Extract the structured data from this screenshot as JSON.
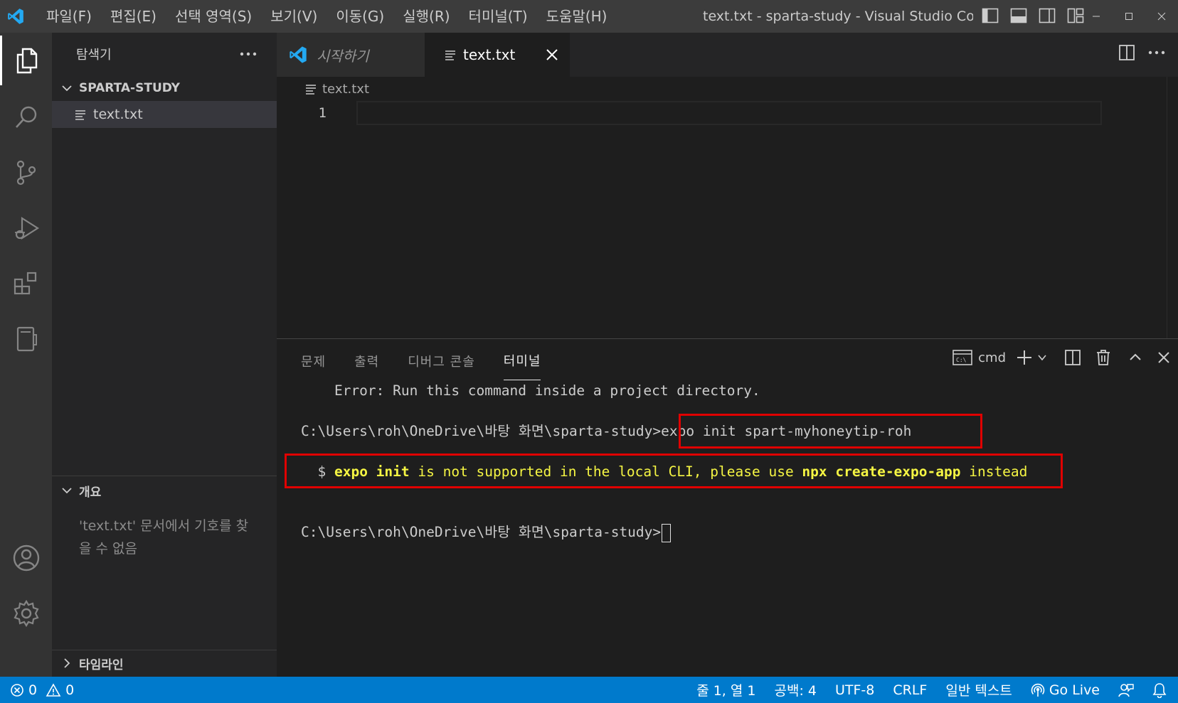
{
  "window": {
    "title": "text.txt - sparta-study - Visual Studio Co...",
    "menu": [
      "파일(F)",
      "편집(E)",
      "선택 영역(S)",
      "보기(V)",
      "이동(G)",
      "실행(R)",
      "터미널(T)",
      "도움말(H)"
    ]
  },
  "sidebar": {
    "title": "탐색기",
    "folder": "SPARTA-STUDY",
    "files": [
      "text.txt"
    ],
    "outline_title": "개요",
    "outline_message": "'text.txt' 문서에서 기호를 찾을 수 없음",
    "timeline_title": "타임라인"
  },
  "editor": {
    "tabs": [
      {
        "label": "시작하기",
        "active": false
      },
      {
        "label": "text.txt",
        "active": true
      }
    ],
    "breadcrumb": "text.txt",
    "line_number": "1"
  },
  "panel": {
    "tabs": [
      "문제",
      "출력",
      "디버그 콘솔",
      "터미널"
    ],
    "active_tab": "터미널",
    "terminal_name": "cmd",
    "lines": {
      "error": "    Error: Run this command inside a project directory.",
      "prompt1": "C:\\Users\\roh\\OneDrive\\바탕 화면\\sparta-study>",
      "cmd1": "expo init spart-myhoneytip-roh",
      "warn_prefix": "  $ ",
      "warn_1": "expo init",
      "warn_2": " is not supported in the local CLI, please use ",
      "warn_3": "npx create-expo-app",
      "warn_4": " instead",
      "prompt2": "C:\\Users\\roh\\OneDrive\\바탕 화면\\sparta-study>"
    }
  },
  "statusbar": {
    "errors": "0",
    "warnings": "0",
    "position": "줄 1, 열 1",
    "indent": "공백: 4",
    "encoding": "UTF-8",
    "eol": "CRLF",
    "language": "일반 텍스트",
    "golive": "Go Live"
  },
  "colors": {
    "accent": "#007acc",
    "highlight_box": "#e00000",
    "terminal_yellow": "#f5f543"
  }
}
